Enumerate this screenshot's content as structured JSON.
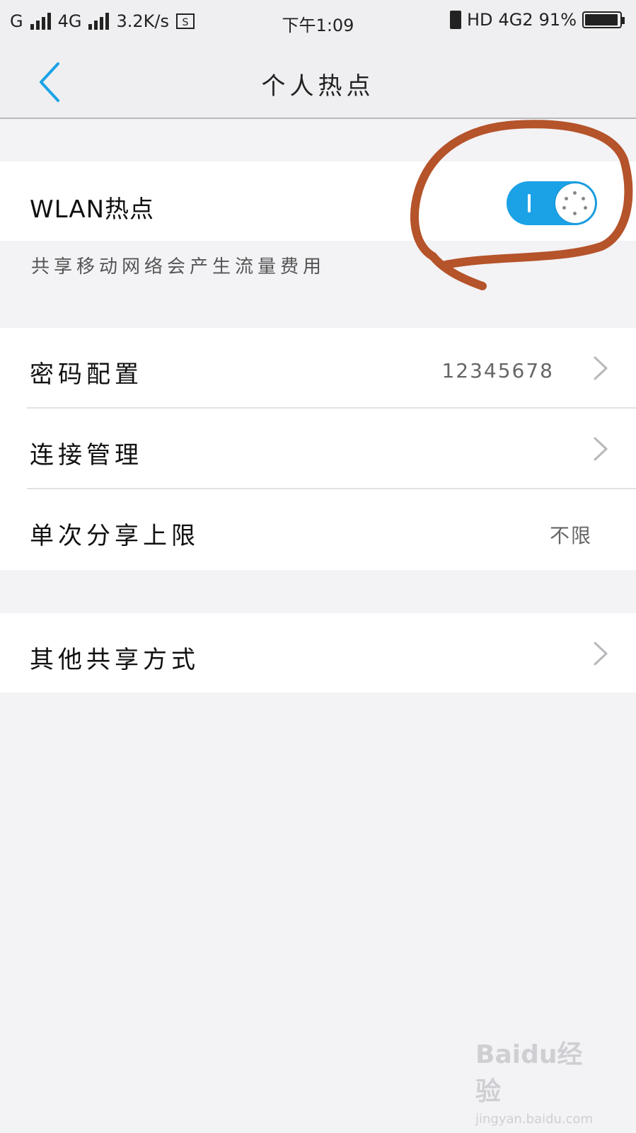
{
  "status_bar": {
    "carrier1": "G",
    "carrier2": "4G",
    "speed": "3.2K/s",
    "screenshot_icon_text": "S",
    "time": "下午1:09",
    "hd": "HD",
    "network": "4G2",
    "battery": "91%"
  },
  "nav": {
    "title": "个人热点"
  },
  "wlan": {
    "label": "WLAN热点",
    "toggle_on": true,
    "hint": "共享移动网络会产生流量费用"
  },
  "settings": [
    {
      "label": "密码配置",
      "value": "12345678",
      "chevron": true
    },
    {
      "label": "连接管理",
      "value": "",
      "chevron": true
    },
    {
      "label": "单次分享上限",
      "value": "不限",
      "chevron": false
    }
  ],
  "other": {
    "label": "其他共享方式"
  },
  "watermark": {
    "logo": "Baidu经验",
    "url": "jingyan.baidu.com"
  },
  "colors": {
    "accent": "#1ba2e6",
    "annotation": "#b5532a",
    "background": "#f3f2f5"
  }
}
